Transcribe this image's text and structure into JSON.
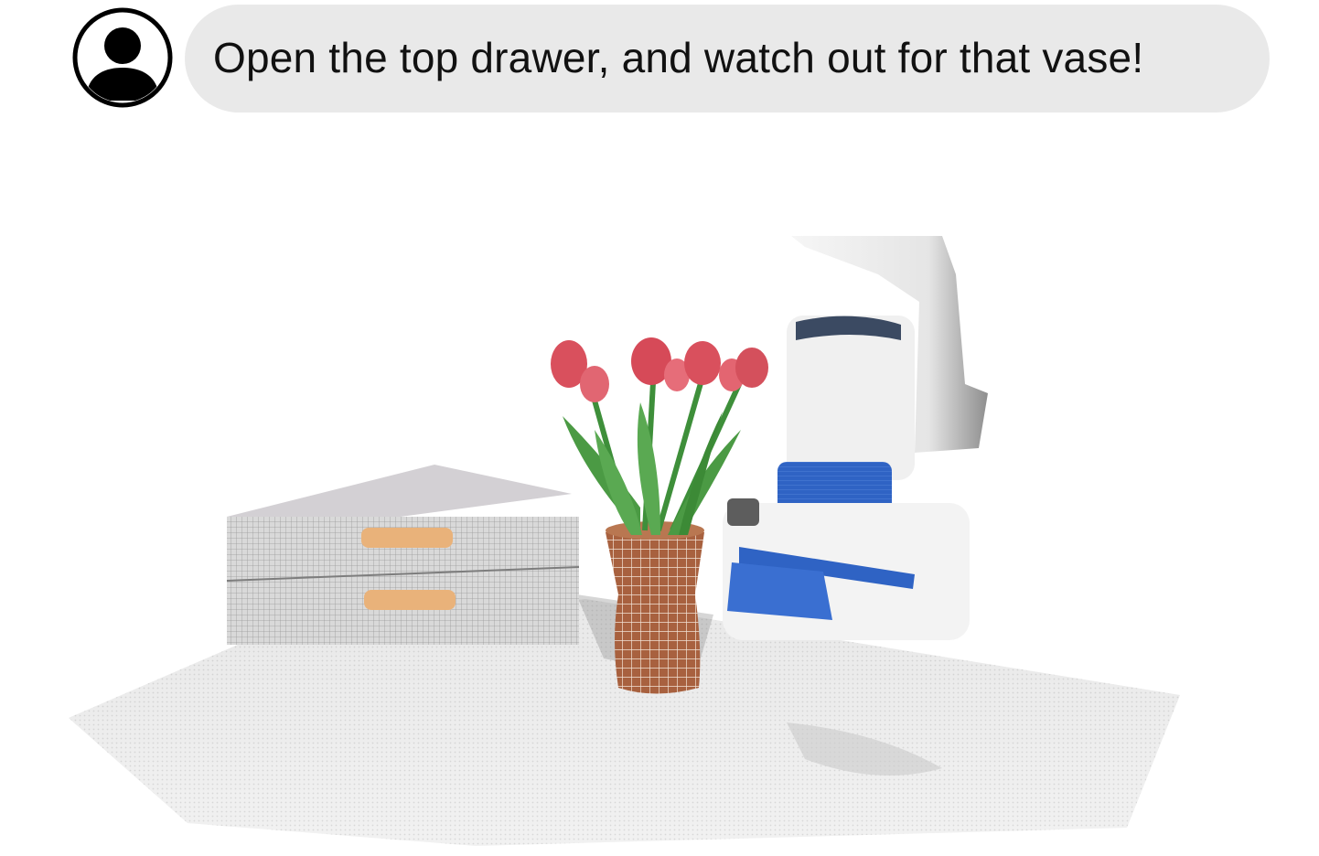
{
  "user": {
    "avatar_icon": "user-avatar-icon"
  },
  "message": {
    "text": "Open the top drawer, and watch out for that vase!"
  },
  "scene": {
    "objects": [
      "drawer-cabinet",
      "vase",
      "tulips",
      "robot-gripper",
      "table-surface"
    ],
    "colors": {
      "bubble_background": "#e9e9e9",
      "vase": "#a8613f",
      "tulip": "#d9505d",
      "stem": "#3e8f3a",
      "gripper": "#2f63c4",
      "robot_body": "#f2f2f2",
      "cabinet": "#dcdcdc",
      "table": "#e6e6e6"
    }
  }
}
